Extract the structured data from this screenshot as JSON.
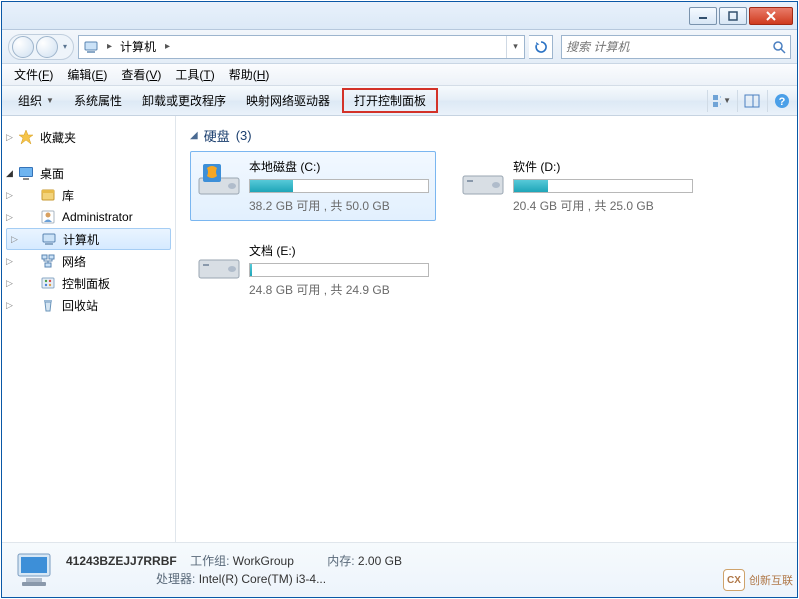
{
  "address": {
    "root_label": "计算机",
    "chevron": "▸"
  },
  "search": {
    "placeholder": "搜索 计算机"
  },
  "menubar": {
    "items": [
      {
        "label": "文件",
        "accel": "F"
      },
      {
        "label": "编辑",
        "accel": "E"
      },
      {
        "label": "查看",
        "accel": "V"
      },
      {
        "label": "工具",
        "accel": "T"
      },
      {
        "label": "帮助",
        "accel": "H"
      }
    ]
  },
  "toolbar": {
    "organize": "组织",
    "items": [
      "系统属性",
      "卸载或更改程序",
      "映射网络驱动器",
      "打开控制面板"
    ],
    "highlight_index": 3
  },
  "sidebar": {
    "favorites_label": "收藏夹",
    "desktop_label": "桌面",
    "desktop_children": [
      {
        "id": "libraries",
        "label": "库"
      },
      {
        "id": "administrator",
        "label": "Administrator"
      },
      {
        "id": "computer",
        "label": "计算机",
        "selected": true
      },
      {
        "id": "network",
        "label": "网络"
      },
      {
        "id": "control-panel",
        "label": "控制面板"
      },
      {
        "id": "recycle-bin",
        "label": "回收站"
      }
    ]
  },
  "main": {
    "group_title": "硬盘",
    "group_count": "(3)",
    "drives": [
      {
        "id": "c",
        "name": "本地磁盘 (C:)",
        "stats": "38.2 GB 可用 , 共 50.0 GB",
        "fill_pct": 24,
        "selected": true,
        "kind": "os"
      },
      {
        "id": "d",
        "name": "软件 (D:)",
        "stats": "20.4 GB 可用 , 共 25.0 GB",
        "fill_pct": 19,
        "selected": false,
        "kind": "hdd"
      },
      {
        "id": "e",
        "name": "文档 (E:)",
        "stats": "24.8 GB 可用 , 共 24.9 GB",
        "fill_pct": 1,
        "selected": false,
        "kind": "hdd"
      }
    ]
  },
  "details": {
    "name": "41243BZEJJ7RRBF",
    "workgroup_label": "工作组:",
    "workgroup_value": "WorkGroup",
    "memory_label": "内存:",
    "memory_value": "2.00 GB",
    "cpu_label": "处理器:",
    "cpu_value": "Intel(R) Core(TM) i3-4..."
  },
  "watermark": {
    "brand": "创新互联"
  }
}
